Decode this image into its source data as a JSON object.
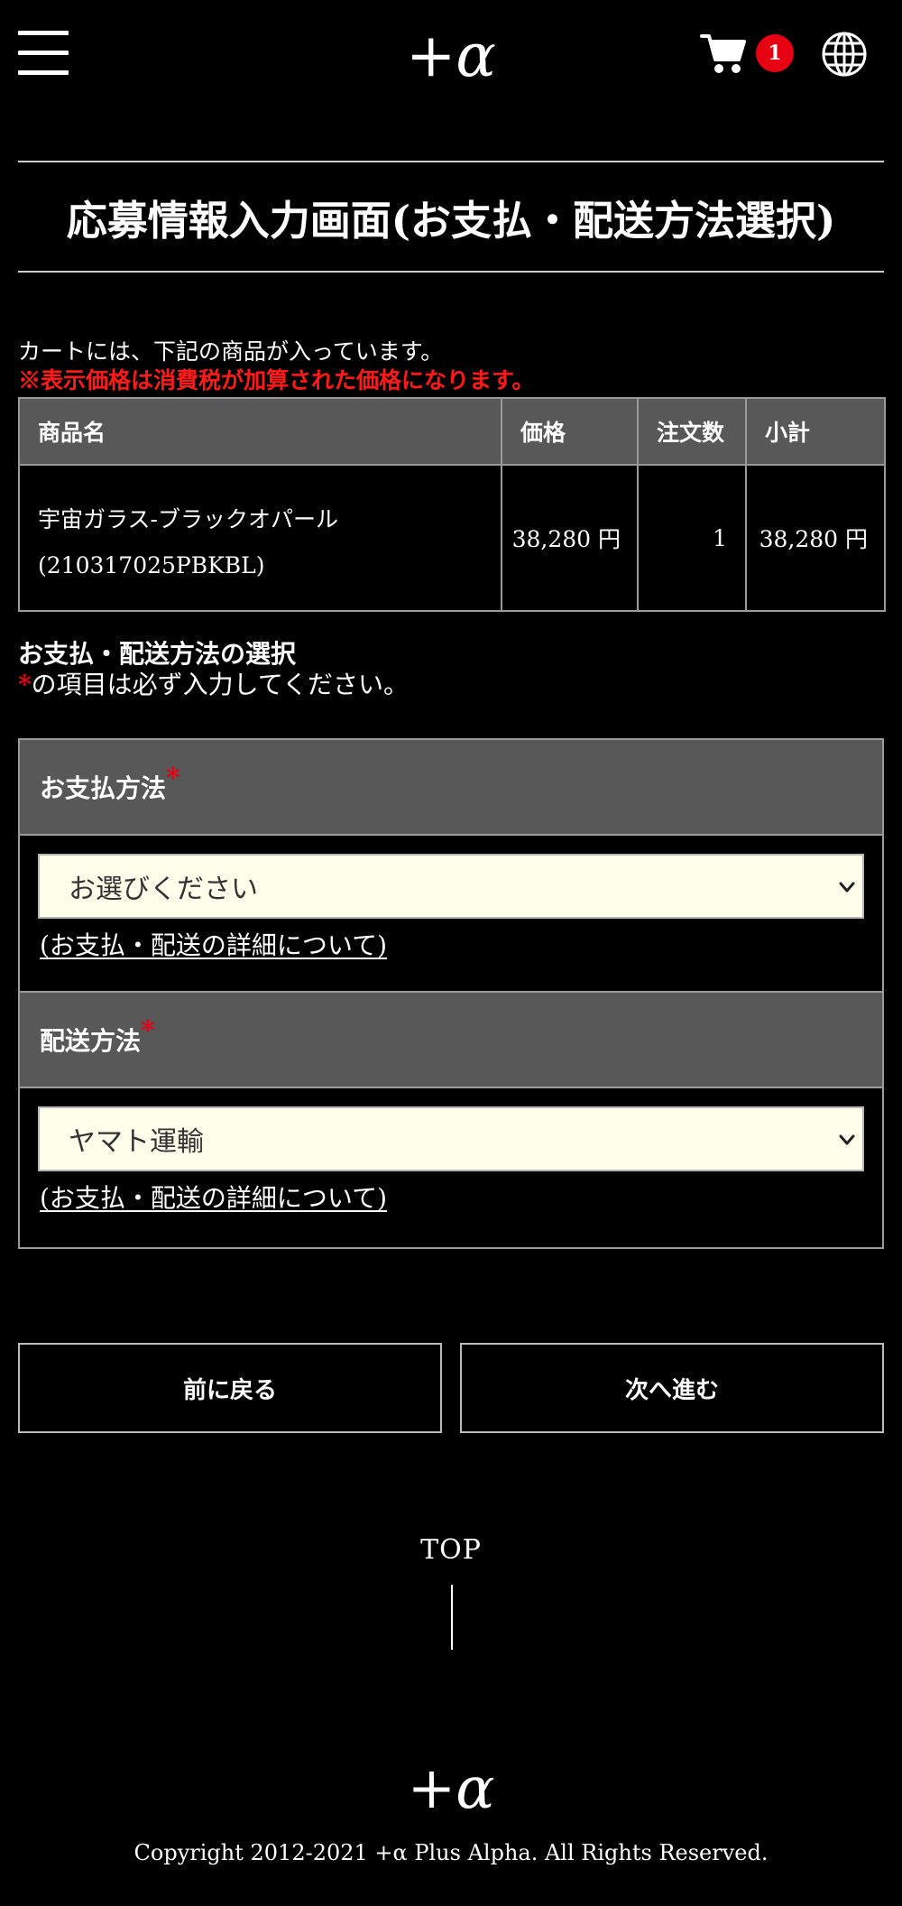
{
  "header": {
    "logo": "+α",
    "cart_count": "1"
  },
  "page": {
    "title": "応募情報入力画面(お支払・配送方法選択)"
  },
  "cart": {
    "intro": "カートには、下記の商品が入っています。",
    "tax_notice": "※表示価格は消費税が加算された価格になります。",
    "columns": [
      "商品名",
      "価格",
      "注文数",
      "小計"
    ],
    "rows": [
      {
        "name": "宇宙ガラス-ブラックオパール",
        "code": "(210317025PBKBL)",
        "price": "38,280 円",
        "qty": "1",
        "subtotal": "38,280 円"
      }
    ]
  },
  "form": {
    "section_title": "お支払・配送方法の選択",
    "required_star": "*",
    "required_note": "の項目は必ず入力してください。",
    "payment": {
      "label": "お支払方法",
      "selected": "お選びください",
      "detail_link": "(お支払・配送の詳細について)"
    },
    "shipping": {
      "label": "配送方法",
      "selected": "ヤマト運輸",
      "detail_link": "(お支払・配送の詳細について)"
    }
  },
  "buttons": {
    "back": "前に戻る",
    "next": "次へ進む"
  },
  "footer": {
    "top_link": "TOP",
    "logo": "+α",
    "copyright": "Copyright 2012-2021 +α Plus Alpha. All Rights Reserved."
  },
  "colors": {
    "background": "#000000",
    "accent_red": "#e60012",
    "table_header": "#585858",
    "select_bg": "#fefeea"
  },
  "icons": [
    "menu-icon",
    "cart-icon",
    "globe-icon",
    "chevron-down-icon"
  ]
}
